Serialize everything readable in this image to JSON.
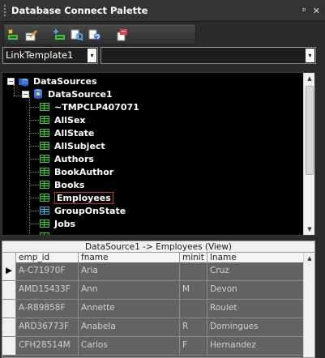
{
  "window": {
    "title": "Database Connect Palette",
    "pin_glyph": "ᵖ",
    "close_glyph": "✕"
  },
  "toolbar": {
    "icons": [
      "new-connection-icon",
      "edit-connection-icon",
      "add-datasource-icon",
      "query-icon",
      "refresh-icon",
      "export-icon"
    ]
  },
  "selector": {
    "template_value": "LinkTemplate1",
    "second_value": "",
    "arrow": "▾"
  },
  "tree": {
    "root": "DataSources",
    "child": "DataSource1",
    "items": [
      {
        "label": "~TMPCLP407071",
        "kind": "table"
      },
      {
        "label": "AllSex",
        "kind": "table"
      },
      {
        "label": "AllState",
        "kind": "table"
      },
      {
        "label": "AllSubject",
        "kind": "table"
      },
      {
        "label": "Authors",
        "kind": "table"
      },
      {
        "label": "BookAuthor",
        "kind": "table"
      },
      {
        "label": "Books",
        "kind": "table"
      },
      {
        "label": "Employees",
        "kind": "table",
        "selected": true
      },
      {
        "label": "GroupOnState",
        "kind": "view"
      },
      {
        "label": "Jobs",
        "kind": "table"
      }
    ]
  },
  "grid": {
    "caption": "DataSource1 -> Employees (View)",
    "columns": [
      "emp_id",
      "fname",
      "minit",
      "lname"
    ],
    "rows": [
      [
        "A-C71970F",
        "Aria",
        "",
        "Cruz"
      ],
      [
        "AMD15433F",
        "Ann",
        "M",
        "Devon"
      ],
      [
        "A-R89858F",
        "Annette",
        "",
        "Roulet"
      ],
      [
        "ARD36773F",
        "Anabela",
        "R",
        "Domingues"
      ],
      [
        "CFH28514M",
        "Carlos",
        "F",
        "Hernandez"
      ]
    ],
    "current_row_marker": "▶"
  },
  "colors": {
    "tree_bg": "#000000",
    "grid_bg": "#5a5a5a",
    "selected_border": "#c0392b"
  }
}
